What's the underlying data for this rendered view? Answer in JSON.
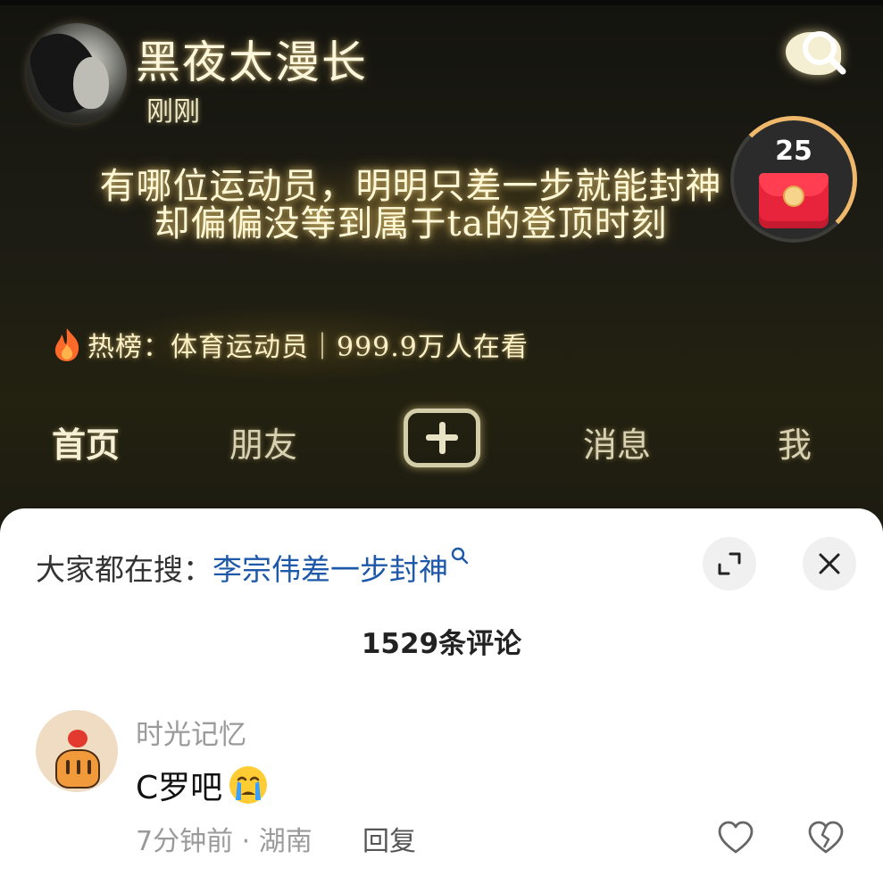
{
  "video": {
    "author_name": "黑夜太漫长",
    "post_time": "刚刚",
    "caption_line1": "有哪位运动员，明明只差一步就能封神",
    "caption_line2": "却偏偏没等到属于ta的登顶时刻",
    "red_packet_count": "25",
    "hot_list_text": "热榜：体育运动员｜999.9万人在看"
  },
  "tabs": {
    "home": "首页",
    "friends": "朋友",
    "messages": "消息",
    "me": "我"
  },
  "sheet": {
    "hot_search_label": "大家都在搜：",
    "hot_search_term": "李宗伟差一步封神",
    "comment_count": "1529条评论"
  },
  "comments": [
    {
      "username": "时光记忆",
      "text": "C罗吧",
      "emoji": "crying-face",
      "time_location": "7分钟前 · 湖南",
      "reply_label": "回复"
    }
  ],
  "colors": {
    "link_blue": "#1e58a8",
    "glow_text": "#fff8d8",
    "red_packet": "#e8243c"
  }
}
